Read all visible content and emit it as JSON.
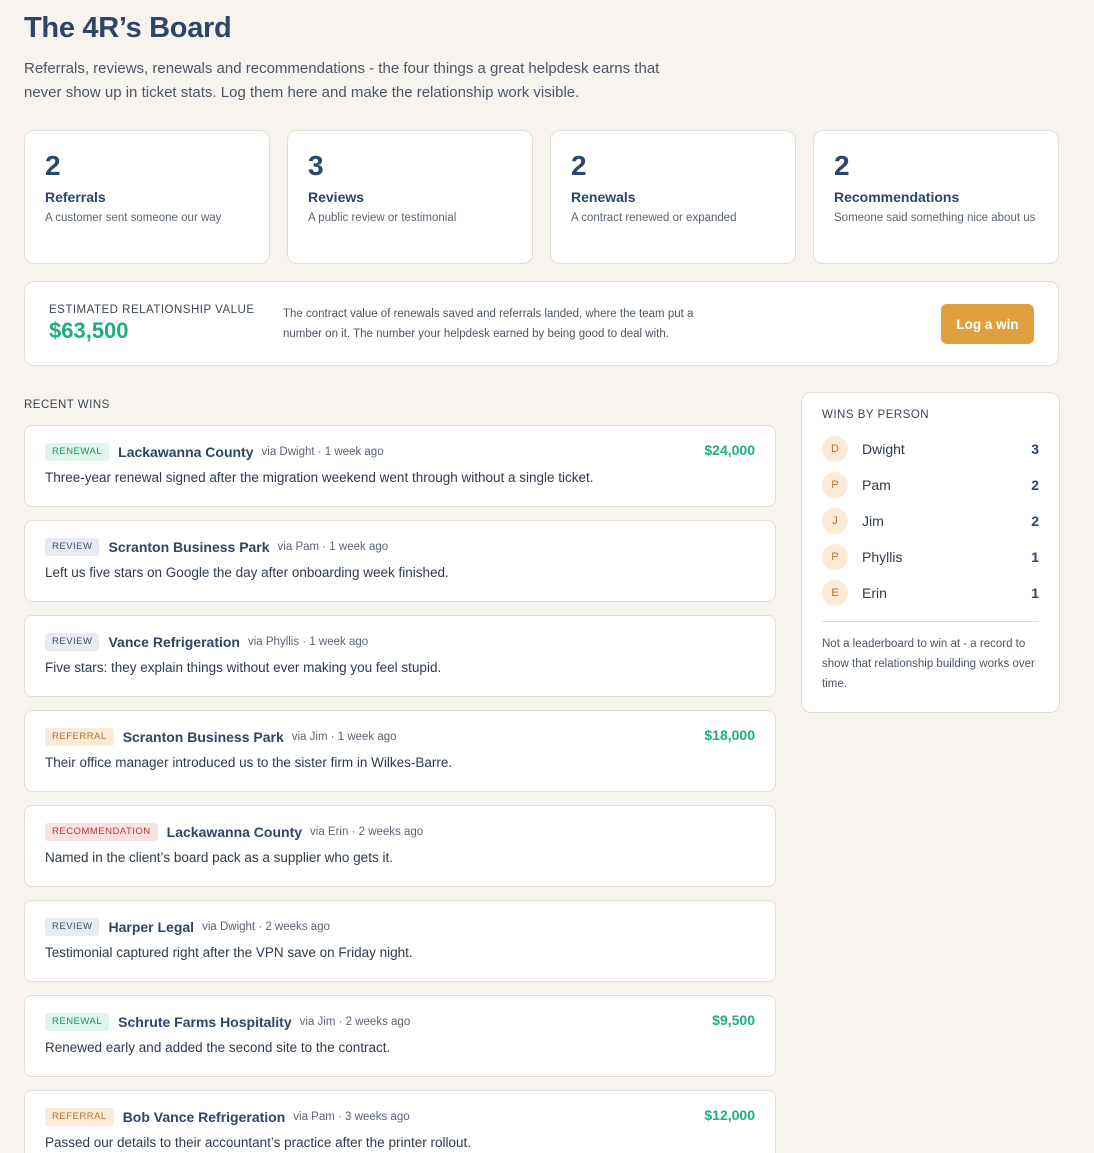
{
  "header": {
    "title": "The 4R’s Board",
    "subtitle": "Referrals, reviews, renewals and recommendations - the four things a great helpdesk earns that never show up in ticket stats. Log them here and make the relationship work visible."
  },
  "stats": [
    {
      "count": "2",
      "label": "Referrals",
      "description": "A customer sent someone our way"
    },
    {
      "count": "3",
      "label": "Reviews",
      "description": "A public review or testimonial"
    },
    {
      "count": "2",
      "label": "Renewals",
      "description": "A contract renewed or expanded"
    },
    {
      "count": "2",
      "label": "Recommendations",
      "description": "Someone said something nice about us"
    }
  ],
  "value": {
    "label": "ESTIMATED RELATIONSHIP VALUE",
    "amount": "$63,500",
    "description": "The contract value of renewals saved and referrals landed, where the team put a number on it. The number your helpdesk earned by being good to deal with.",
    "button_label": "Log a win"
  },
  "recent_wins": {
    "label": "RECENT WINS",
    "items": [
      {
        "tag": "RENEWAL",
        "type": "renewal",
        "client": "Lackawanna County",
        "meta": "via Dwight · 1 week ago",
        "amount": "$24,000",
        "text": "Three-year renewal signed after the migration weekend went through without a single ticket."
      },
      {
        "tag": "REVIEW",
        "type": "review",
        "client": "Scranton Business Park",
        "meta": "via Pam · 1 week ago",
        "amount": "",
        "text": "Left us five stars on Google the day after onboarding week finished."
      },
      {
        "tag": "REVIEW",
        "type": "review",
        "client": "Vance Refrigeration",
        "meta": "via Phyllis · 1 week ago",
        "amount": "",
        "text": "Five stars: they explain things without ever making you feel stupid."
      },
      {
        "tag": "REFERRAL",
        "type": "referral",
        "client": "Scranton Business Park",
        "meta": "via Jim · 1 week ago",
        "amount": "$18,000",
        "text": "Their office manager introduced us to the sister firm in Wilkes-Barre."
      },
      {
        "tag": "RECOMMENDATION",
        "type": "recommendation",
        "client": "Lackawanna County",
        "meta": "via Erin · 2 weeks ago",
        "amount": "",
        "text": "Named in the client’s board pack as a supplier who gets it."
      },
      {
        "tag": "REVIEW",
        "type": "review",
        "client": "Harper Legal",
        "meta": "via Dwight · 2 weeks ago",
        "amount": "",
        "text": "Testimonial captured right after the VPN save on Friday night."
      },
      {
        "tag": "RENEWAL",
        "type": "renewal",
        "client": "Schrute Farms Hospitality",
        "meta": "via Jim · 2 weeks ago",
        "amount": "$9,500",
        "text": "Renewed early and added the second site to the contract."
      },
      {
        "tag": "REFERRAL",
        "type": "referral",
        "client": "Bob Vance Refrigeration",
        "meta": "via Pam · 3 weeks ago",
        "amount": "$12,000",
        "text": "Passed our details to their accountant’s practice after the printer rollout."
      }
    ]
  },
  "wins_by_person": {
    "label": "WINS BY PERSON",
    "people": [
      {
        "initial": "D",
        "name": "Dwight",
        "count": "3"
      },
      {
        "initial": "P",
        "name": "Pam",
        "count": "2"
      },
      {
        "initial": "J",
        "name": "Jim",
        "count": "2"
      },
      {
        "initial": "P",
        "name": "Phyllis",
        "count": "1"
      },
      {
        "initial": "E",
        "name": "Erin",
        "count": "1"
      }
    ],
    "note": "Not a leaderboard to win at - a record to show that relationship building works over time."
  }
}
